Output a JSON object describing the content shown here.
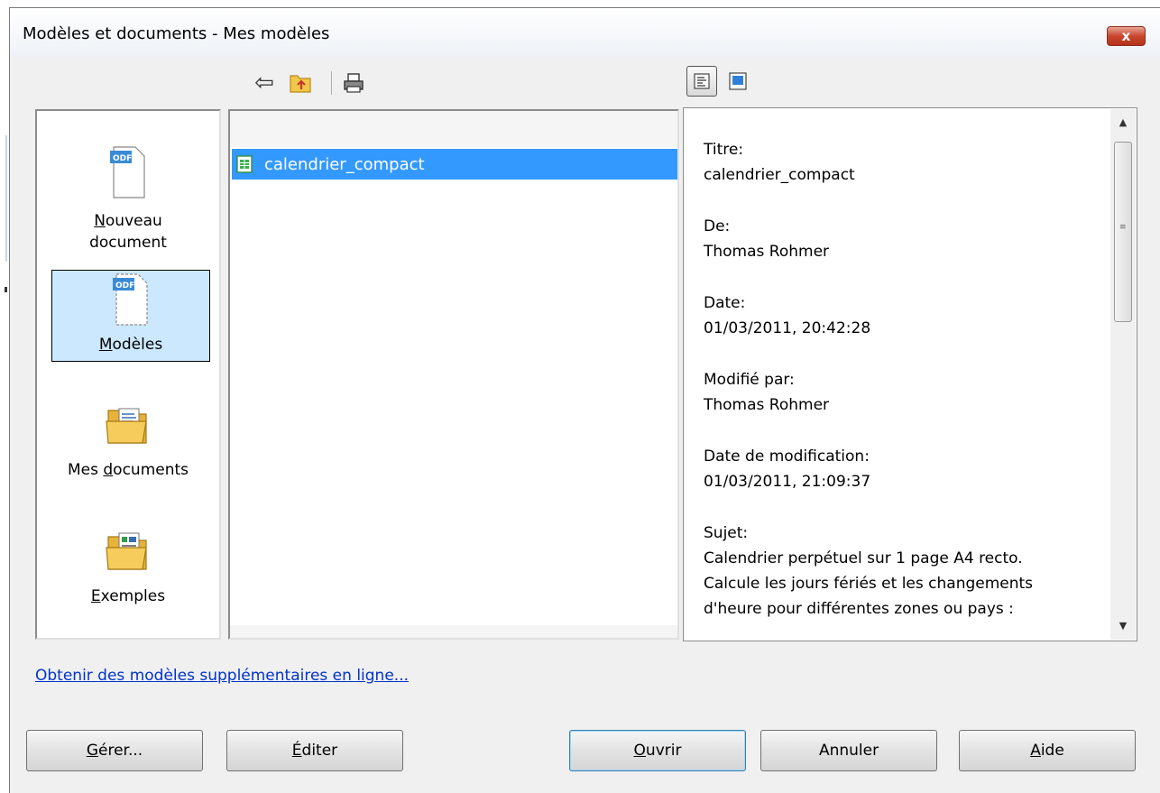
{
  "window": {
    "title": "Modèles et documents - Mes modèles",
    "close_label": "x"
  },
  "toolbar": {
    "back_icon": "back-arrow-icon",
    "up_icon": "folder-up-icon",
    "print_icon": "print-icon",
    "details_icon": "view-details-icon",
    "preview_icon": "view-preview-icon"
  },
  "categories": [
    {
      "label_line1": "Nouveau",
      "label_line2": "document",
      "icon": "odf-document-icon",
      "selected": false
    },
    {
      "label_line1": "Modèles",
      "label_line2": "",
      "icon": "odf-template-icon",
      "selected": true
    },
    {
      "label_line1": "Mes documents",
      "label_line2": "",
      "icon": "folder-documents-icon",
      "selected": false
    },
    {
      "label_line1": "Exemples",
      "label_line2": "",
      "icon": "folder-examples-icon",
      "selected": false
    }
  ],
  "files": [
    {
      "name": "calendrier_compact",
      "icon": "spreadsheet-icon",
      "selected": true
    }
  ],
  "info": {
    "title_label": "Titre:",
    "title_value": "calendrier_compact",
    "author_label": "De:",
    "author_value": "Thomas Rohmer",
    "date_label": "Date:",
    "date_value": "01/03/2011, 20:42:28",
    "modified_by_label": "Modifié par:",
    "modified_by_value": "Thomas Rohmer",
    "modified_date_label": "Date de modification:",
    "modified_date_value": "01/03/2011, 21:09:37",
    "subject_label": "Sujet:",
    "subject_line1": "Calendrier perpétuel sur 1 page A4 recto.",
    "subject_line2": "Calcule les jours fériés et les changements",
    "subject_line3": "d'heure pour différentes zones ou pays :"
  },
  "link": {
    "online_templates": "Obtenir des modèles supplémentaires en ligne..."
  },
  "buttons": {
    "manage": {
      "accel": "G",
      "rest": "érer..."
    },
    "edit": {
      "accel": "É",
      "rest": "diter"
    },
    "open": {
      "accel": "O",
      "rest": "uvrir"
    },
    "cancel": {
      "label": "Annuler"
    },
    "help": {
      "accel": "A",
      "rest": "ide"
    }
  },
  "colors": {
    "selection": "#3399ff",
    "category_selected": "#cce8ff",
    "link": "#0033cc",
    "close_button": "#c9472f"
  }
}
